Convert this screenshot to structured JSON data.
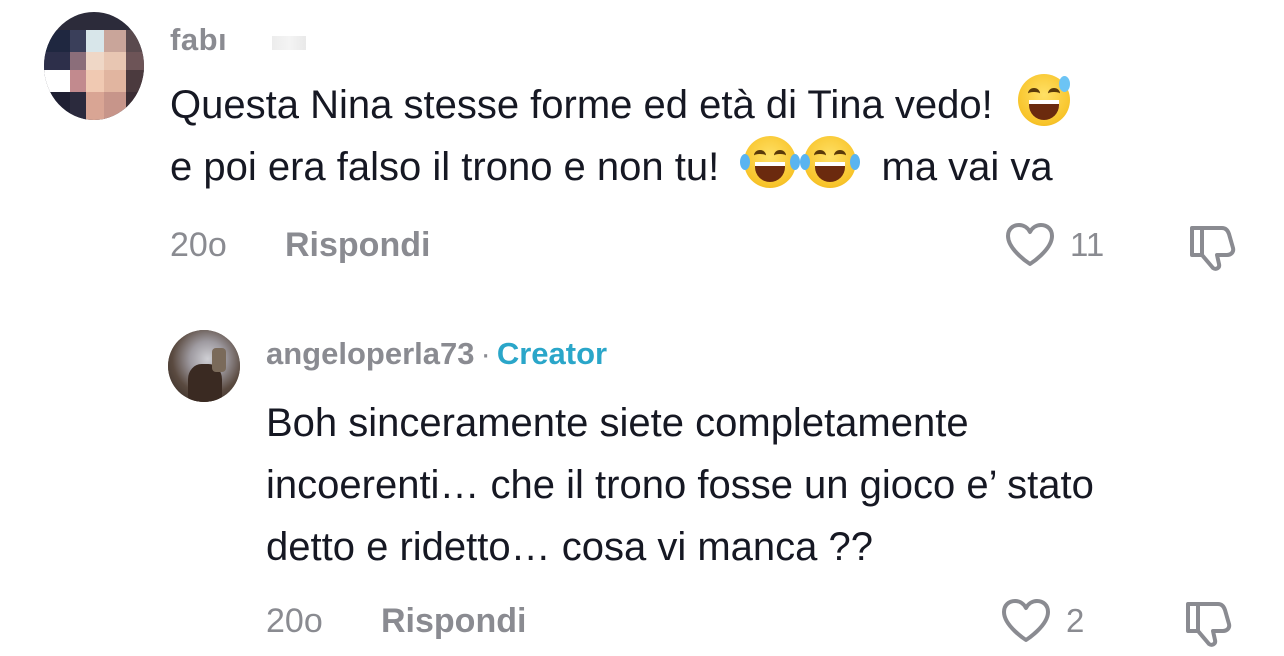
{
  "comments": [
    {
      "username": "fabı",
      "text_line1": "Questa Nina stesse forme ed età di Tina vedo!",
      "text_line2_a": "e poi era falso il trono e non tu!",
      "text_line2_b": "ma vai va",
      "time": "20o",
      "reply_label": "Rispondi",
      "likes": "11",
      "emojis": [
        "grinning-sweat-emoji",
        "tears-of-joy-emoji",
        "tears-of-joy-emoji"
      ]
    },
    {
      "username": "angeloperla73",
      "separator": "·",
      "badge": "Creator",
      "text_line1": "Boh sinceramente siete completamente",
      "text_line2": "incoerenti… che il trono fosse un gioco e’ stato",
      "text_line3": "detto e ridetto… cosa vi manca ??",
      "time": "20o",
      "reply_label": "Rispondi",
      "likes": "2"
    }
  ],
  "colors": {
    "text": "#161823",
    "muted": "#8a8b91",
    "creator_badge": "#2aa6c9"
  }
}
